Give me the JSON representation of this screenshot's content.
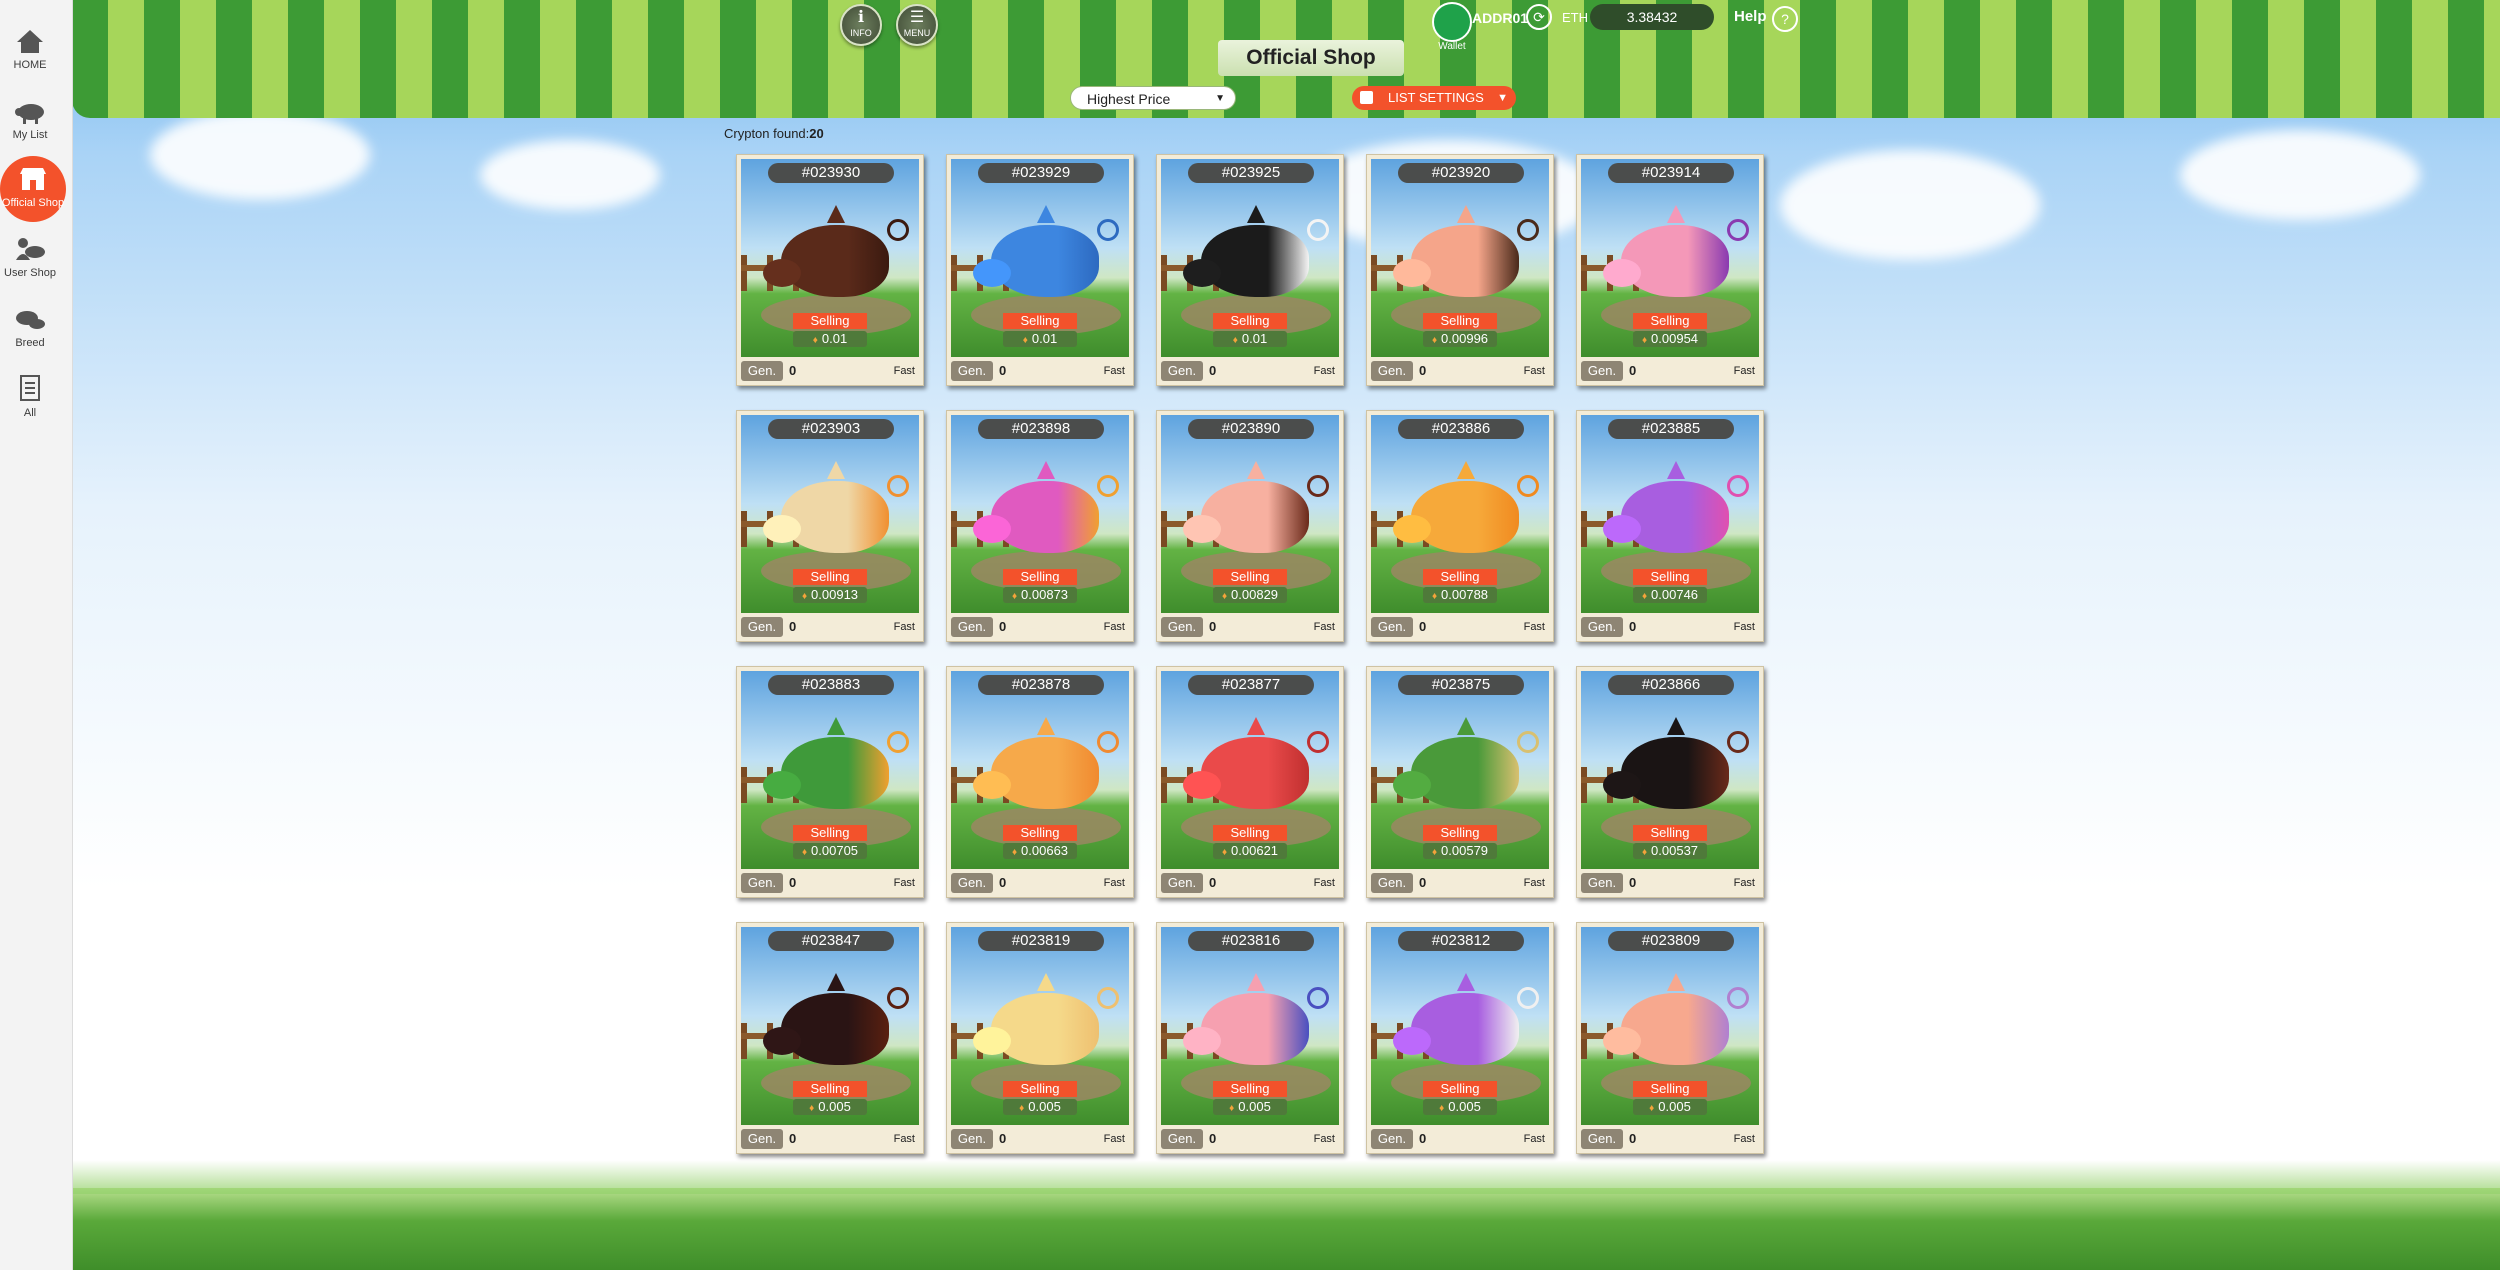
{
  "sidebar": {
    "items": [
      {
        "label": "HOME",
        "icon": "home-icon"
      },
      {
        "label": "My List",
        "icon": "pig-icon"
      },
      {
        "label": "Official Shop",
        "icon": "shop-icon",
        "active": true
      },
      {
        "label": "User Shop",
        "icon": "user-shop-icon"
      },
      {
        "label": "Breed",
        "icon": "breed-icon"
      },
      {
        "label": "All",
        "icon": "list-icon"
      }
    ]
  },
  "header": {
    "info_label": "INFO",
    "menu_label": "MENU",
    "wallet_label": "Wallet",
    "address": "ADDR01",
    "eth_label": "ETH",
    "eth_value": "3.38432",
    "help_label": "Help",
    "title": "Official Shop"
  },
  "controls": {
    "sort_selected": "Highest Price",
    "list_settings_label": "LIST SETTINGS"
  },
  "results": {
    "found_label": "Crypton found:",
    "found_count": "20"
  },
  "colors": {
    "accent": "#f3522b",
    "awning_dark": "#3d9b35",
    "awning_light": "#a6d65a"
  },
  "cards": [
    {
      "id": "#023930",
      "status": "Selling",
      "price": "0.01",
      "gen_label": "Gen.",
      "gen": "0",
      "speed": "Fast",
      "color": "#5a2a1a",
      "accent": "#3b1a10"
    },
    {
      "id": "#023929",
      "status": "Selling",
      "price": "0.01",
      "gen_label": "Gen.",
      "gen": "0",
      "speed": "Fast",
      "color": "#3d86e0",
      "accent": "#2d6ac0"
    },
    {
      "id": "#023925",
      "status": "Selling",
      "price": "0.01",
      "gen_label": "Gen.",
      "gen": "0",
      "speed": "Fast",
      "color": "#1b1b1b",
      "accent": "#f4f4f4"
    },
    {
      "id": "#023920",
      "status": "Selling",
      "price": "0.00996",
      "gen_label": "Gen.",
      "gen": "0",
      "speed": "Fast",
      "color": "#f5a58a",
      "accent": "#4a2a1a"
    },
    {
      "id": "#023914",
      "status": "Selling",
      "price": "0.00954",
      "gen_label": "Gen.",
      "gen": "0",
      "speed": "Fast",
      "color": "#f498b8",
      "accent": "#8a3ab0"
    },
    {
      "id": "#023903",
      "status": "Selling",
      "price": "0.00913",
      "gen_label": "Gen.",
      "gen": "0",
      "speed": "Fast",
      "color": "#efd7a6",
      "accent": "#f09030"
    },
    {
      "id": "#023898",
      "status": "Selling",
      "price": "0.00873",
      "gen_label": "Gen.",
      "gen": "0",
      "speed": "Fast",
      "color": "#e05ac0",
      "accent": "#f0a030"
    },
    {
      "id": "#023890",
      "status": "Selling",
      "price": "0.00829",
      "gen_label": "Gen.",
      "gen": "0",
      "speed": "Fast",
      "color": "#f7b0a0",
      "accent": "#6a2a1a"
    },
    {
      "id": "#023886",
      "status": "Selling",
      "price": "0.00788",
      "gen_label": "Gen.",
      "gen": "0",
      "speed": "Fast",
      "color": "#f6a93a",
      "accent": "#f08a20"
    },
    {
      "id": "#023885",
      "status": "Selling",
      "price": "0.00746",
      "gen_label": "Gen.",
      "gen": "0",
      "speed": "Fast",
      "color": "#a85ee0",
      "accent": "#e050b0"
    },
    {
      "id": "#023883",
      "status": "Selling",
      "price": "0.00705",
      "gen_label": "Gen.",
      "gen": "0",
      "speed": "Fast",
      "color": "#3f9a3a",
      "accent": "#f0a030"
    },
    {
      "id": "#023878",
      "status": "Selling",
      "price": "0.00663",
      "gen_label": "Gen.",
      "gen": "0",
      "speed": "Fast",
      "color": "#f6a94a",
      "accent": "#f08a30"
    },
    {
      "id": "#023877",
      "status": "Selling",
      "price": "0.00621",
      "gen_label": "Gen.",
      "gen": "0",
      "speed": "Fast",
      "color": "#ea4a4a",
      "accent": "#c03030"
    },
    {
      "id": "#023875",
      "status": "Selling",
      "price": "0.00579",
      "gen_label": "Gen.",
      "gen": "0",
      "speed": "Fast",
      "color": "#4a9a3a",
      "accent": "#d8c070"
    },
    {
      "id": "#023866",
      "status": "Selling",
      "price": "0.00537",
      "gen_label": "Gen.",
      "gen": "0",
      "speed": "Fast",
      "color": "#1a1414",
      "accent": "#6a2a1a"
    },
    {
      "id": "#023847",
      "status": "Selling",
      "price": "0.005",
      "gen_label": "Gen.",
      "gen": "0",
      "speed": "Fast",
      "color": "#2a1414",
      "accent": "#5a2010"
    },
    {
      "id": "#023819",
      "status": "Selling",
      "price": "0.005",
      "gen_label": "Gen.",
      "gen": "0",
      "speed": "Fast",
      "color": "#f5d98a",
      "accent": "#eec070"
    },
    {
      "id": "#023816",
      "status": "Selling",
      "price": "0.005",
      "gen_label": "Gen.",
      "gen": "0",
      "speed": "Fast",
      "color": "#f6a0b0",
      "accent": "#4a50c0"
    },
    {
      "id": "#023812",
      "status": "Selling",
      "price": "0.005",
      "gen_label": "Gen.",
      "gen": "0",
      "speed": "Fast",
      "color": "#a85ee0",
      "accent": "#f0f0f0"
    },
    {
      "id": "#023809",
      "status": "Selling",
      "price": "0.005",
      "gen_label": "Gen.",
      "gen": "0",
      "speed": "Fast",
      "color": "#f7a88e",
      "accent": "#b080d0"
    }
  ]
}
